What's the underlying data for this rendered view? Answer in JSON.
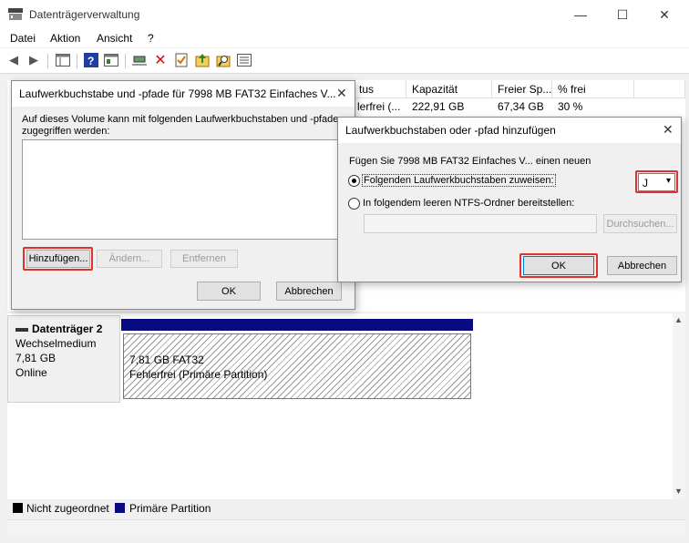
{
  "window": {
    "title": "Datenträgerverwaltung",
    "controls": {
      "minimize": "—",
      "maximize": "☐",
      "close": "✕"
    }
  },
  "menu": [
    "Datei",
    "Aktion",
    "Ansicht",
    "?"
  ],
  "volume_list": {
    "columns": [
      "tus",
      "Kapazität",
      "Freier Sp...",
      "% frei"
    ],
    "row": [
      "lerfrei (...",
      "222,91 GB",
      "67,34 GB",
      "30 %"
    ]
  },
  "disk": {
    "name": "Datenträger 2",
    "type": "Wechselmedium",
    "size": "7,81 GB",
    "status": "Online",
    "partition_size": "7,81 GB FAT32",
    "partition_status": "Fehlerfrei (Primäre Partition)"
  },
  "legend": [
    {
      "label": "Nicht zugeordnet",
      "color": "#000000"
    },
    {
      "label": "Primäre Partition",
      "color": "#0a0a80"
    }
  ],
  "dialog1": {
    "title": "Laufwerkbuchstabe und -pfade für 7998 MB FAT32 Einfaches V...",
    "description_line1": "Auf dieses Volume kann mit folgenden Laufwerkbuchstaben und -pfaden",
    "description_line2": "zugegriffen werden:",
    "add_label": "Hinzufügen...",
    "change_label": "Ändern...",
    "remove_label": "Entfernen",
    "ok_label": "OK",
    "cancel_label": "Abbrechen"
  },
  "dialog2": {
    "title": "Laufwerkbuchstaben oder -pfad hinzufügen",
    "intro": "Fügen Sie 7998 MB FAT32 Einfaches V... einen neuen",
    "option_assign": "Folgenden Laufwerkbuchstaben zuweisen:",
    "drive_letter": "J",
    "option_folder": "In folgendem leeren NTFS-Ordner bereitstellen:",
    "browse_label": "Durchsuchen...",
    "ok_label": "OK",
    "cancel_label": "Abbrechen"
  },
  "colors": {
    "highlight": "#e03131",
    "partition_bar": "#0a0a80",
    "focus": "#0078d7"
  }
}
